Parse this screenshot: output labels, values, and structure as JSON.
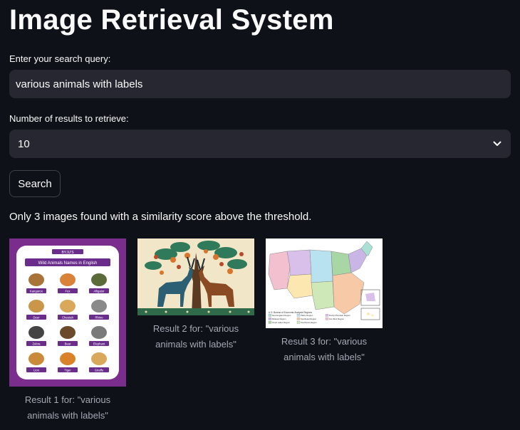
{
  "app": {
    "title": "Image Retrieval System"
  },
  "query": {
    "label": "Enter your search query:",
    "value": "various animals with labels"
  },
  "num_results": {
    "label": "Number of results to retrieve:",
    "selected": "10"
  },
  "search_button": {
    "label": "Search"
  },
  "status": {
    "message": "Only 3 images found with a similarity score above the threshold."
  },
  "results": [
    {
      "caption_line1": "Result 1 for: \"various",
      "caption_line2": "animals with labels\"",
      "image_title": "Wild Animals Names in English",
      "image_brand": "BYJU'S",
      "animal_labels": [
        "Kangaroo",
        "Fox",
        "Alligator",
        "Deer",
        "Cheetah",
        "Rhino",
        "Zebra",
        "Bear",
        "Elephant",
        "Lion",
        "Tiger",
        "Giraffe"
      ]
    },
    {
      "caption_line1": "Result 2 for: \"various",
      "caption_line2": "animals with labels\""
    },
    {
      "caption_line1": "Result 3 for: \"various",
      "caption_line2": "animals with labels\"",
      "image_title": "U.S. Bureau of Economic Analysis Regions",
      "legend": [
        "New England Region",
        "Mideast Region",
        "Great Lakes Region",
        "Plains Region",
        "Southeast Region",
        "Southwest Region",
        "Rocky Mountain Region",
        "Far West Region"
      ]
    }
  ],
  "colors": {
    "background": "#0e1117",
    "input_bg": "#262730",
    "text": "#fafafa",
    "caption": "#a3a8b4",
    "poster_purple": "#7b2d8e"
  }
}
